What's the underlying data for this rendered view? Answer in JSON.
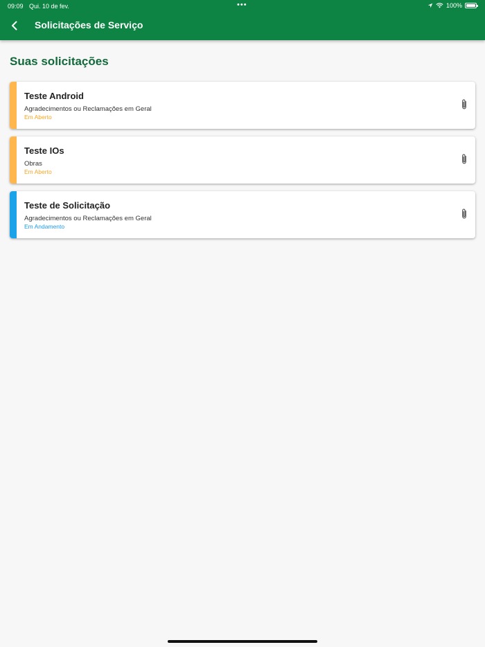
{
  "status_bar": {
    "time": "09:09",
    "date": "Qui. 10 de fev.",
    "dots": "•••",
    "battery": "100%"
  },
  "appbar": {
    "title": "Solicitações de Serviço",
    "color": "#0d8443"
  },
  "section": {
    "title": "Suas solicitações"
  },
  "requests": [
    {
      "title": "Teste Android",
      "category": "Agradecimentos ou Reclamações em Geral",
      "status": "Em Aberto",
      "status_color": "#f5a623",
      "stripe_color": "#ffb74d",
      "icon": "paperclip-icon"
    },
    {
      "title": "Teste IOs",
      "category": "Obras",
      "status": "Em Aberto",
      "status_color": "#f5a623",
      "stripe_color": "#ffb74d",
      "icon": "paperclip-icon"
    },
    {
      "title": "Teste de Solicitação",
      "category": "Agradecimentos ou Reclamações em Geral",
      "status": "Em Andamento",
      "status_color": "#1e9be8",
      "stripe_color": "#1aa3e8",
      "icon": "paperclip-icon"
    }
  ]
}
